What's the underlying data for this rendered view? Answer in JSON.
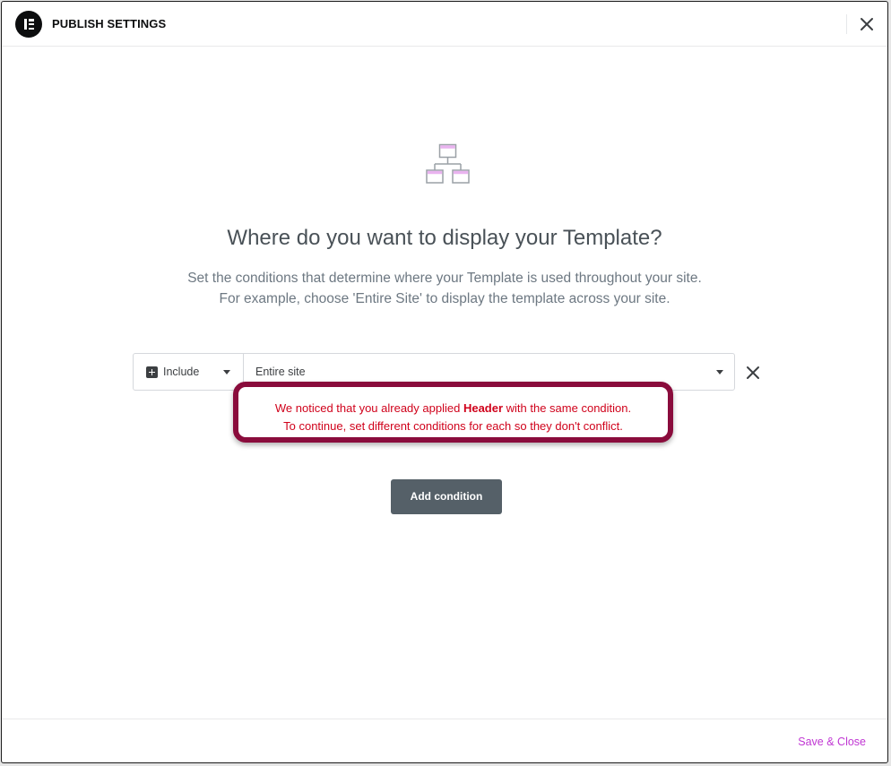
{
  "header": {
    "title": "PUBLISH SETTINGS",
    "logo_icon": "elementor-logo-icon",
    "close_icon": "close-icon"
  },
  "main": {
    "icon": "sitemap-icon",
    "heading": "Where do you want to display your Template?",
    "description_line1": "Set the conditions that determine where your Template is used throughout your site.",
    "description_line2": "For example, choose 'Entire Site' to display the template across your site."
  },
  "condition": {
    "type_icon": "plus-square-icon",
    "type_value": "Include",
    "site_value": "Entire site",
    "remove_icon": "close-icon"
  },
  "warning": {
    "line1_before": "We noticed that you already applied ",
    "line1_bold": "Header",
    "line1_after": " with the same condition.",
    "line2": "To continue, set different conditions for each so they don't conflict."
  },
  "actions": {
    "add_condition": "Add condition"
  },
  "footer": {
    "save_close": "Save & Close"
  },
  "colors": {
    "accent": "#c036d3",
    "warning_text": "#d0021b",
    "highlight_border": "#8a0c3c",
    "button_bg": "#556068",
    "icon_pink": "#e9b3ef"
  }
}
